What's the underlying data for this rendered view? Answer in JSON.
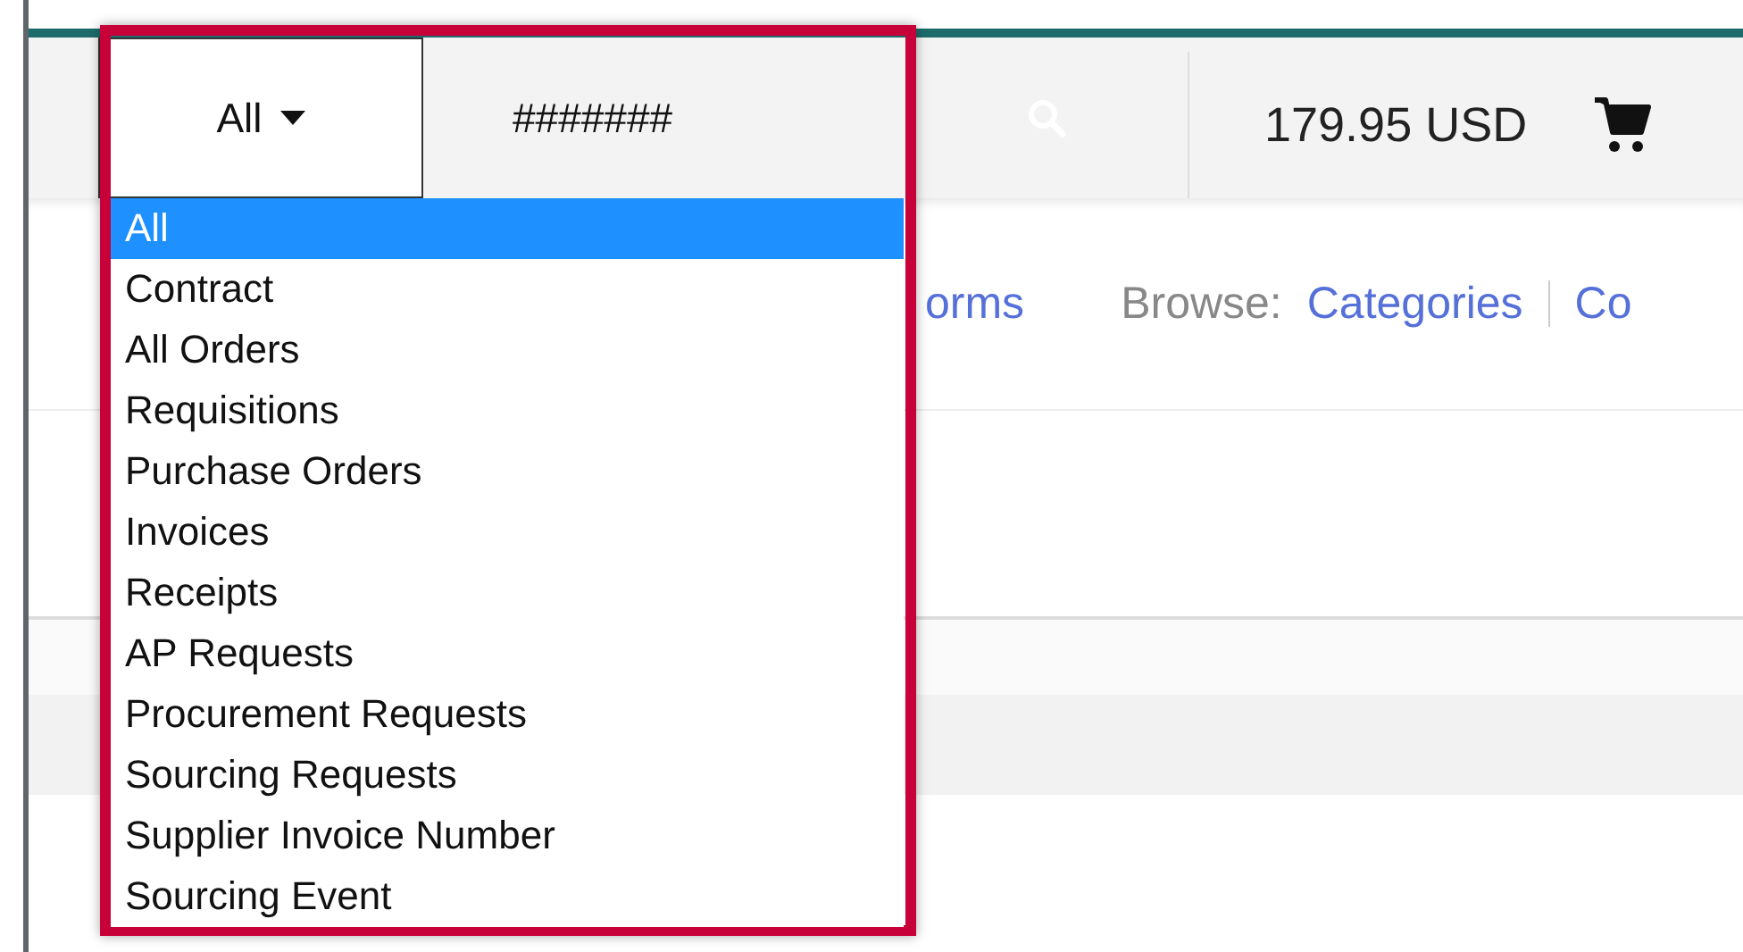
{
  "search": {
    "scope": "All",
    "value": "#######"
  },
  "cart": {
    "total": "179.95 USD"
  },
  "nav": {
    "link_fragment": "orms",
    "browse_label": "Browse:",
    "links": [
      "Categories",
      "Co"
    ]
  },
  "dropdown": {
    "options": [
      {
        "label": "All",
        "selected": true
      },
      {
        "label": "Contract",
        "selected": false
      },
      {
        "label": "All Orders",
        "selected": false
      },
      {
        "label": "Requisitions",
        "selected": false
      },
      {
        "label": "Purchase Orders",
        "selected": false
      },
      {
        "label": "Invoices",
        "selected": false
      },
      {
        "label": "Receipts",
        "selected": false
      },
      {
        "label": "AP Requests",
        "selected": false
      },
      {
        "label": "Procurement Requests",
        "selected": false
      },
      {
        "label": "Sourcing Requests",
        "selected": false
      },
      {
        "label": "Supplier Invoice Number",
        "selected": false
      },
      {
        "label": "Sourcing Event",
        "selected": false
      }
    ]
  }
}
